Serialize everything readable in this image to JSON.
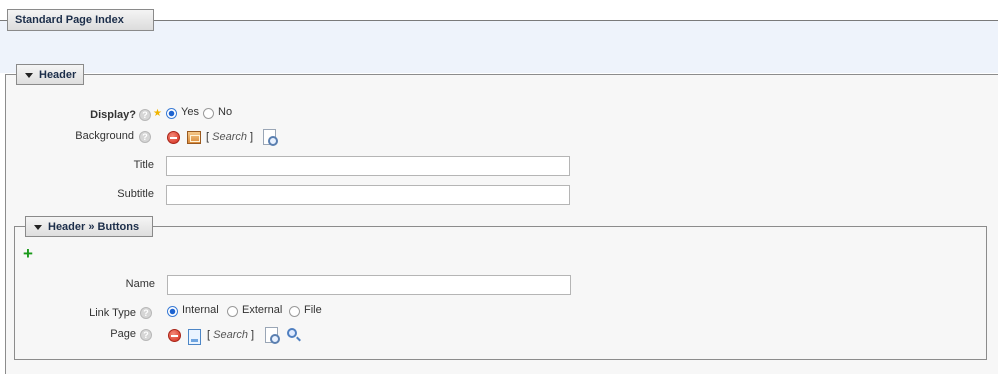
{
  "page": {
    "title": "Standard Page Index"
  },
  "header_section": {
    "legend": "Header",
    "display": {
      "label": "Display?",
      "options": [
        "Yes",
        "No"
      ],
      "selected": "Yes"
    },
    "background": {
      "label": "Background",
      "search_prefix": "[",
      "search_label": "Search",
      "search_suffix": "]"
    },
    "title_field": {
      "label": "Title",
      "value": ""
    },
    "subtitle_field": {
      "label": "Subtitle",
      "value": ""
    }
  },
  "buttons_section": {
    "legend": "Header » Buttons",
    "add_icon": "plus-icon",
    "name_field": {
      "label": "Name",
      "value": ""
    },
    "link_type": {
      "label": "Link Type",
      "options": [
        "Internal",
        "External",
        "File"
      ],
      "selected": "Internal"
    },
    "page": {
      "label": "Page",
      "search_prefix": "[",
      "search_label": "Search",
      "search_suffix": "]"
    }
  },
  "help_glyph": "?",
  "required_glyph": "★",
  "colors": {
    "band": "#eef3fb",
    "radio_selected": "#1d63d0",
    "add_green": "#1a9a1a",
    "remove_red": "#d2291a"
  }
}
